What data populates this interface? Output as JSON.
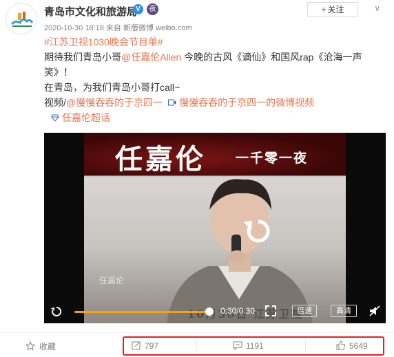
{
  "post": {
    "author": "青岛市文化和旅游局",
    "verified_badge": "V",
    "medal": "夜",
    "timestamp": "2020-10-30 18:18",
    "source_prefix": "来自",
    "source": "新版微博 weibo.com",
    "follow_label": "关注",
    "hashtag": "#江苏卫视1030晚会节目单#",
    "text_line1_a": "期待我们青岛小哥",
    "mention": "@任嘉伦Allen",
    "text_line1_b": " 今晚的古风《谪仙》和国风rap《沧海一声笑》！",
    "text_line2": "在青岛，为我们青岛小哥打call~",
    "video_prefix": "视频/",
    "video_author": "@慢慢吞吞的于京四一",
    "video_link": "慢慢吞吞的于京四一的微博视频",
    "supertopic": "任嘉伦超话"
  },
  "video": {
    "title_main": "任嘉伦",
    "title_sub": "一千零一夜",
    "watermark": "任嘉伦",
    "date_overlay": "10月30日 江苏卫视",
    "time": "0:30/0:30",
    "progress": 1.0,
    "speed_label": "倍速",
    "quality_label": "高清"
  },
  "footer": {
    "favorite_label": "收藏",
    "reposts": "797",
    "comments": "1191",
    "likes": "5649"
  },
  "colors": {
    "accent": "#ff8200",
    "link": "#eb7350",
    "blue": "#2e6db3",
    "highlight": "#e3201b"
  }
}
